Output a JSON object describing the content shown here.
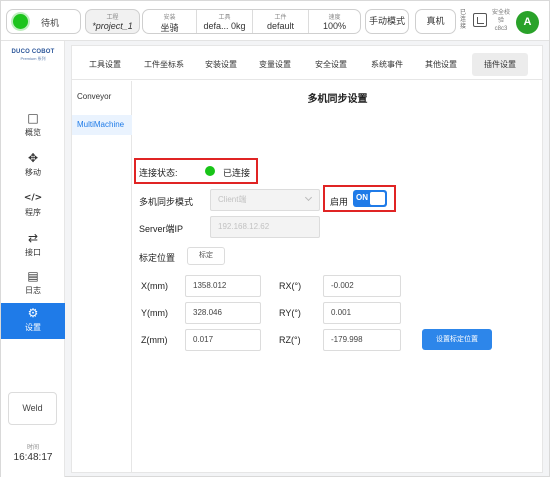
{
  "topbar": {
    "status_label": "待机",
    "project_caption": "工程",
    "project_value": "*project_1",
    "install_caption": "安装",
    "install_value": "坐骑",
    "tool_caption": "工具",
    "tool_value": "defa... 0kg",
    "workpiece_caption": "工件",
    "workpiece_value": "default",
    "speed_caption": "速度",
    "speed_value": "100%",
    "manual_mode": "手动模式",
    "real_machine": "真机",
    "vertical_label": "已连接",
    "safety_line1": "安全校验",
    "safety_line2": "c8c3",
    "avatar_letter": "A"
  },
  "sidebar": {
    "logo_line1": "DUCO COBOT",
    "logo_line2": "Premium 系列",
    "items": [
      {
        "icon": "□",
        "label": "概览"
      },
      {
        "icon": "✥",
        "label": "移动"
      },
      {
        "icon": "</>",
        "label": "程序"
      },
      {
        "icon": "⇄",
        "label": "接口"
      },
      {
        "icon": "▤",
        "label": "日志"
      },
      {
        "icon": "⚙",
        "label": "设置"
      }
    ],
    "weld": "Weld",
    "time_caption": "时间",
    "time_value": "16:48:17"
  },
  "tabs": [
    "工具设置",
    "工件坐标系",
    "安装设置",
    "变量设置",
    "安全设置",
    "系统事件",
    "其他设置",
    "插件设置"
  ],
  "plugins": [
    "Conveyor",
    "MultiMachine"
  ],
  "content": {
    "title": "多机同步设置",
    "connection_label": "连接状态:",
    "connection_value": "已连接",
    "sync_mode_label": "多机同步模式",
    "sync_mode_value": "Client端",
    "enable_label": "启用",
    "toggle_label": "ON",
    "server_ip_label": "Server端IP",
    "server_ip_value": "192.168.12.62",
    "calib_label": "标定位置",
    "calib_button": "标定",
    "x_label": "X(mm)",
    "x_value": "1358.012",
    "y_label": "Y(mm)",
    "y_value": "328.046",
    "z_label": "Z(mm)",
    "z_value": "0.017",
    "rx_label": "RX(°)",
    "rx_value": "-0.002",
    "ry_label": "RY(°)",
    "ry_value": "0.001",
    "rz_label": "RZ(°)",
    "rz_value": "-179.998",
    "set_calib_button": "设置标定位置"
  },
  "colors": {
    "accent": "#1f7be8",
    "status_green": "#18c418",
    "highlight_red": "#e02424"
  }
}
